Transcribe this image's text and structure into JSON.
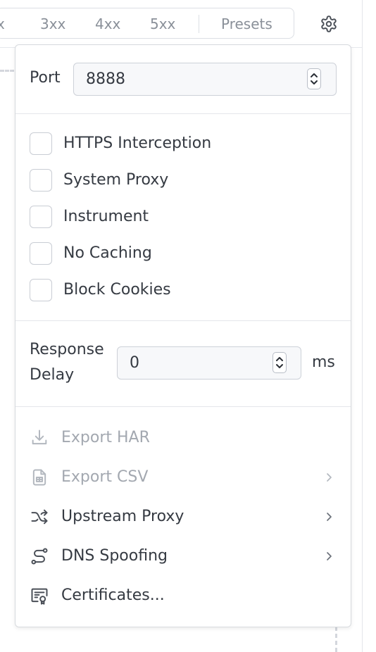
{
  "toolbar": {
    "status_filters": [
      "x",
      "3xx",
      "4xx",
      "5xx"
    ],
    "presets_label": "Presets"
  },
  "settings": {
    "port": {
      "label": "Port",
      "value": "8888"
    },
    "toggles": [
      {
        "label": "HTTPS Interception",
        "checked": false
      },
      {
        "label": "System Proxy",
        "checked": false
      },
      {
        "label": "Instrument",
        "checked": false
      },
      {
        "label": "No Caching",
        "checked": false
      },
      {
        "label": "Block Cookies",
        "checked": false
      }
    ],
    "response_delay": {
      "label_line1": "Response",
      "label_line2": "Delay",
      "value": "0",
      "unit": "ms"
    },
    "menu": [
      {
        "label": "Export HAR",
        "icon": "download-icon",
        "disabled": true,
        "submenu": false
      },
      {
        "label": "Export CSV",
        "icon": "csv-file-icon",
        "disabled": true,
        "submenu": true
      },
      {
        "label": "Upstream Proxy",
        "icon": "shuffle-icon",
        "disabled": false,
        "submenu": true
      },
      {
        "label": "DNS Spoofing",
        "icon": "route-icon",
        "disabled": false,
        "submenu": true
      },
      {
        "label": "Certificates...",
        "icon": "certificate-icon",
        "disabled": false,
        "submenu": false
      }
    ]
  },
  "colors": {
    "text": "#353a42",
    "muted_text": "#a3a8b0",
    "filter_text": "#8a9099",
    "border": "#d7dade"
  }
}
